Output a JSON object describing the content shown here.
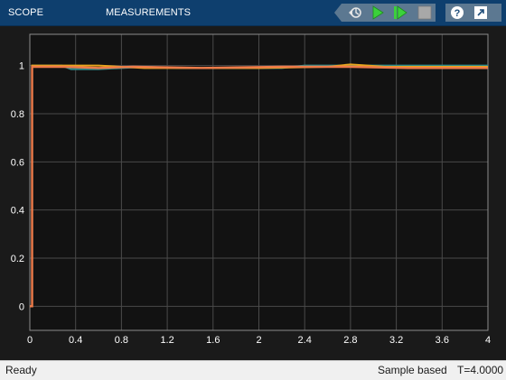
{
  "toolstrip": {
    "tabs": [
      {
        "label": "SCOPE"
      },
      {
        "label": "MEASUREMENTS"
      }
    ],
    "buttons": [
      {
        "icon": "step-back-icon"
      },
      {
        "icon": "run-icon"
      },
      {
        "icon": "step-forward-icon"
      },
      {
        "icon": "stop-icon"
      },
      {
        "icon": "help-icon"
      },
      {
        "icon": "undock-icon"
      }
    ],
    "colors": {
      "bar": "#0e3f6e",
      "group": "#5c7891",
      "run_green": "#3bd13b",
      "stop_gray": "#a8a8a8"
    }
  },
  "plot": {
    "colors": {
      "background": "#121212",
      "axes_box": "#8c8c8c",
      "grid": "#4a4a4a",
      "tick_text": "#ffffff"
    },
    "x_ticks": [
      "0",
      "0.4",
      "0.8",
      "1.2",
      "1.6",
      "2",
      "2.4",
      "2.8",
      "3.2",
      "3.6",
      "4"
    ],
    "y_ticks": [
      "0",
      "0.2",
      "0.4",
      "0.6",
      "0.8",
      "1"
    ],
    "grid": true
  },
  "chart_data": {
    "type": "line",
    "title": "",
    "xlabel": "",
    "ylabel": "",
    "xlim": [
      0,
      4
    ],
    "ylim": [
      -0.1,
      1.13
    ],
    "series": [
      {
        "color": "#2e8b8b",
        "x": [
          0,
          0.02,
          0.02,
          0.28,
          0.36,
          0.6,
          0.8,
          1.0,
          1.3,
          2.2,
          2.4,
          2.8,
          3.0,
          3.1,
          4.0
        ],
        "y": [
          0,
          0,
          1.0,
          1.0,
          0.985,
          0.985,
          0.99,
          0.995,
          0.99,
          0.99,
          1.0,
          1.0,
          1.0,
          1.0,
          1.0
        ]
      },
      {
        "color": "#e8a61d",
        "x": [
          0,
          0.02,
          0.02,
          0.6,
          1.0,
          1.5,
          2.0,
          2.6,
          2.8,
          2.95,
          3.1,
          4.0
        ],
        "y": [
          0,
          0,
          1.0,
          1.0,
          0.99,
          0.99,
          0.99,
          0.995,
          1.005,
          1.0,
          0.995,
          0.995
        ]
      },
      {
        "color": "#ee7b4a",
        "x": [
          0,
          0.02,
          0.02,
          0.3,
          0.6,
          0.9,
          1.5,
          2.2,
          2.8,
          3.3,
          4.0
        ],
        "y": [
          0,
          0,
          0.995,
          0.995,
          0.99,
          0.995,
          0.99,
          0.995,
          0.995,
          0.99,
          0.99
        ]
      }
    ]
  },
  "status": {
    "left": "Ready",
    "mode": "Sample based",
    "time": "T=4.0000"
  }
}
